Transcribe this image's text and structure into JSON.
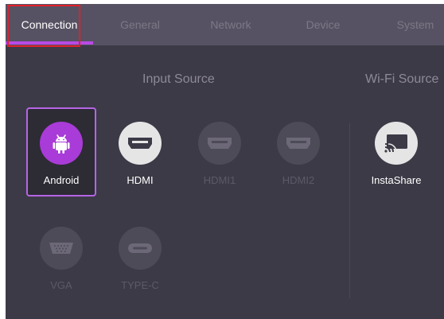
{
  "tabs": [
    {
      "label": "Connection",
      "active": true
    },
    {
      "label": "General",
      "active": false
    },
    {
      "label": "Network",
      "active": false
    },
    {
      "label": "Device",
      "active": false
    },
    {
      "label": "System",
      "active": false
    }
  ],
  "sections": {
    "input_source": {
      "title": "Input Source"
    },
    "wifi_source": {
      "title": "Wi-Fi Source"
    }
  },
  "sources": [
    {
      "label": "Android",
      "icon": "android-icon",
      "state": "selected"
    },
    {
      "label": "HDMI",
      "icon": "hdmi-icon",
      "state": "enabled"
    },
    {
      "label": "HDMI1",
      "icon": "hdmi-icon",
      "state": "disabled"
    },
    {
      "label": "HDMI2",
      "icon": "hdmi-icon",
      "state": "disabled"
    },
    {
      "label": "VGA",
      "icon": "vga-icon",
      "state": "disabled"
    },
    {
      "label": "TYPE-C",
      "icon": "usb-c-icon",
      "state": "disabled"
    }
  ],
  "wifi_sources": [
    {
      "label": "InstaShare",
      "icon": "screen-cast-icon",
      "state": "enabled"
    }
  ],
  "colors": {
    "accent": "#b84ae6",
    "background": "#3d3a47",
    "tab_bar": "#575263",
    "annotation": "#e0202a"
  }
}
